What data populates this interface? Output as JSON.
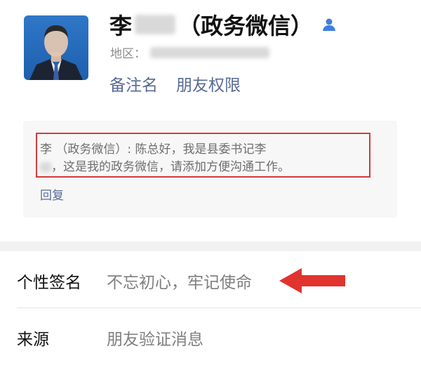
{
  "profile": {
    "name_surname": "李",
    "name_suffix": "（政务微信）",
    "region_label": "地区：",
    "remark_label": "备注名",
    "permission_label": "朋友权限"
  },
  "request": {
    "message_line1": "李  （政务微信）: 陈总好，我是县委书记李",
    "message_line2": "，这是我的政务微信，请添加方便沟通工作。",
    "reply_label": "回复"
  },
  "signature": {
    "label": "个性签名",
    "value": "不忘初心，牢记使命"
  },
  "source": {
    "label": "来源",
    "value": "朋友验证消息"
  },
  "colors": {
    "link": "#576b95",
    "highlight_border": "#d43a3a",
    "arrow": "#e0342f",
    "contact_icon": "#3d7fe0"
  }
}
